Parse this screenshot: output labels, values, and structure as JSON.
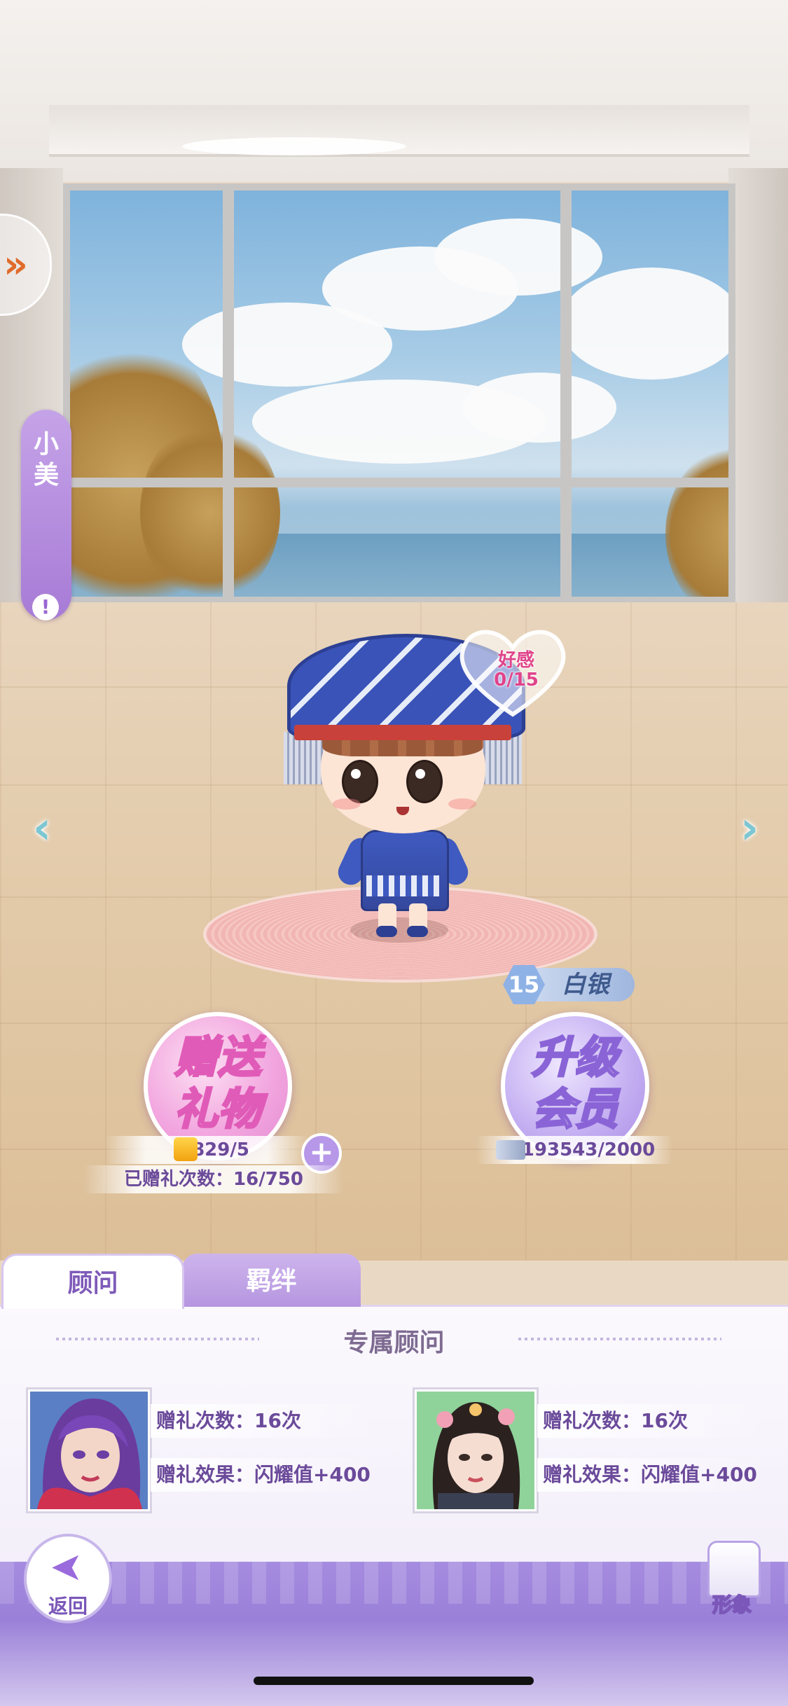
{
  "character": {
    "name": "小美",
    "affection_label": "好感",
    "affection_value": "0/15"
  },
  "gift": {
    "button_label_line1": "赠送",
    "button_label_line2": "礼物",
    "stock": "829/5",
    "count_label": "已赠礼次数：16/750"
  },
  "vip": {
    "level": "15",
    "rank": "白银",
    "button_label_line1": "升级",
    "button_label_line2": "会员",
    "progress": "193543/2000"
  },
  "tabs": [
    {
      "label": "顾问",
      "active": true
    },
    {
      "label": "羁绊",
      "active": false
    }
  ],
  "section_title": "专属顾问",
  "advisors": [
    {
      "gift_count": "赠礼次数：16次",
      "gift_effect": "赠礼效果：闪耀值+400"
    },
    {
      "gift_count": "赠礼次数：16次",
      "gift_effect": "赠礼效果：闪耀值+400"
    }
  ],
  "footer": {
    "back_label": "返回",
    "look_label": "形象"
  },
  "icons": {
    "side": "double-chevron-right-icon",
    "info": "exclamation-icon",
    "prev": "chevron-left-icon",
    "next": "chevron-right-icon",
    "heart": "heart-icon",
    "bag": "gift-bag-icon",
    "card": "member-card-icon",
    "add": "plus-icon",
    "back": "back-arrow-icon",
    "look": "outfit-icon"
  },
  "colors": {
    "accent": "#a77bd6",
    "affection": "#e0448a",
    "text": "#6b4a9a"
  }
}
